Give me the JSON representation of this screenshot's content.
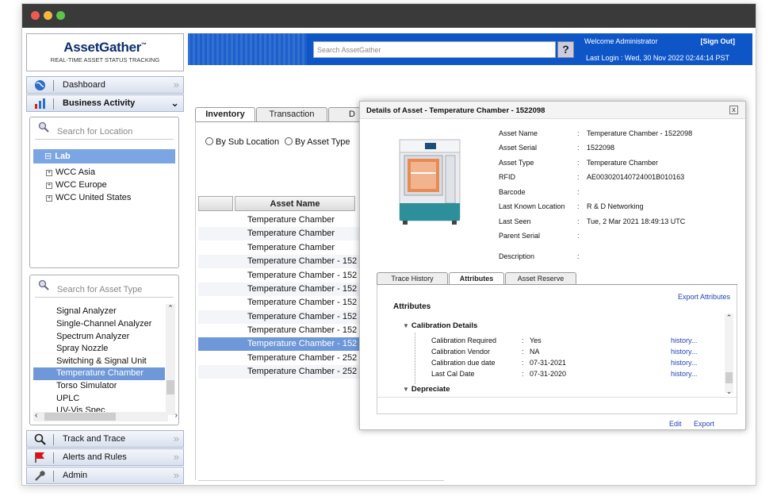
{
  "logo": {
    "brand": "AssetGather",
    "tm": "™",
    "tagline": "REAL-TIME ASSET STATUS TRACKING"
  },
  "header": {
    "search_placeholder": "Search AssetGather",
    "help": "?",
    "welcome": "Welcome  Administrator",
    "signout": "[Sign Out]",
    "last_login": "Last Login :   Wed, 30 Nov 2022 02:44:14 PST"
  },
  "nav": {
    "dashboard": "Dashboard",
    "business_activity": "Business Activity",
    "track_and_trace": "Track and Trace",
    "alerts_and_rules": "Alerts and Rules",
    "admin": "Admin"
  },
  "location_panel": {
    "search_placeholder": "Search for Location",
    "root": "Lab",
    "children": [
      "WCC Asia",
      "WCC Europe",
      "WCC United States"
    ]
  },
  "asset_type_panel": {
    "search_placeholder": "Search for Asset Type",
    "items": [
      "Signal Analyzer",
      "Single-Channel Analyzer",
      "Spectrum Analyzer",
      "Spray Nozzle",
      "Switching & Signal Unit",
      "Temperature Chamber",
      "Torso Simulator",
      "UPLC",
      "UV-Vis Spec"
    ],
    "selected": "Temperature Chamber"
  },
  "main": {
    "tabs": [
      "Inventory",
      "Transaction",
      "D"
    ],
    "radios": [
      "By Sub Location",
      "By Asset Type"
    ],
    "column_header": "Asset Name",
    "rows": [
      "Temperature Chamber",
      "Temperature Chamber",
      "Temperature Chamber",
      "Temperature Chamber - 152",
      "Temperature Chamber - 152",
      "Temperature Chamber - 152",
      "Temperature Chamber - 152",
      "Temperature Chamber - 152",
      "Temperature Chamber - 152",
      "Temperature Chamber - 152",
      "Temperature Chamber - 252",
      "Temperature Chamber - 252"
    ]
  },
  "dialog": {
    "title": "Details of Asset - Temperature Chamber - 1522098",
    "close": "x",
    "fields": [
      {
        "label": "Asset Name",
        "value": "Temperature Chamber - 1522098"
      },
      {
        "label": "Asset Serial",
        "value": "1522098"
      },
      {
        "label": "Asset Type",
        "value": "Temperature Chamber"
      },
      {
        "label": "RFID",
        "value": "AE003020140724001B010163"
      },
      {
        "label": "Barcode",
        "value": ""
      },
      {
        "label": "Last Known Location",
        "value": "R & D Networking"
      },
      {
        "label": "Last Seen",
        "value": "Tue, 2 Mar 2021 18:49:13 UTC"
      },
      {
        "label": "Parent Serial",
        "value": ""
      },
      {
        "label": "Description",
        "value": ""
      }
    ],
    "tabs": [
      "Trace History",
      "Attributes",
      "Asset Reserve"
    ],
    "export_attributes": "Export Attributes",
    "attributes_title": "Attributes",
    "section_calibration": "Calibration Details",
    "calibration": [
      {
        "label": "Calibration Required",
        "value": "Yes",
        "link": "history..."
      },
      {
        "label": "Calibration Vendor",
        "value": "NA",
        "link": "history..."
      },
      {
        "label": "Calibration due date",
        "value": "07-31-2021",
        "link": "history..."
      },
      {
        "label": "Last Cal Date",
        "value": "07-31-2020",
        "link": "history..."
      }
    ],
    "section_depreciate": "Depreciate",
    "edit": "Edit",
    "export": "Export"
  },
  "colors": {
    "header_blue": "#0e56c8",
    "selection_blue": "#6f98d9",
    "link_blue": "#2244bb"
  }
}
